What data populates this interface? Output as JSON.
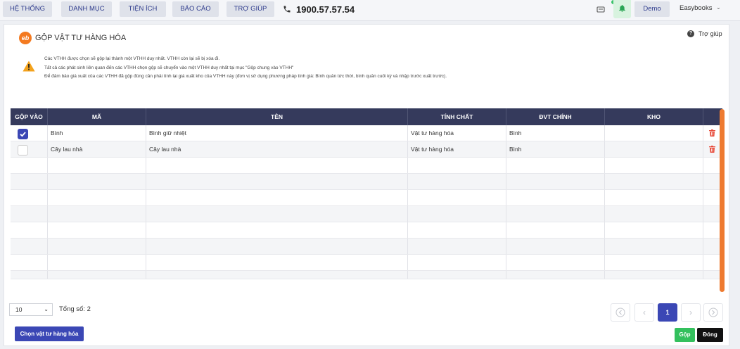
{
  "nav": {
    "items": [
      "HỆ THỐNG",
      "DANH MỤC",
      "TIỆN ÍCH",
      "BÁO CÁO",
      "TRỢ GIÚP"
    ],
    "hotline": "1900.57.57.54",
    "user": "Demo",
    "company": "Easybooks"
  },
  "icons": {
    "phone": "phone-icon",
    "tray": "tray-icon",
    "bell": "bell-icon",
    "warning": "warning-icon",
    "trash": "trash-icon",
    "help": "question-circle-icon"
  },
  "colors": {
    "primary": "#3b47b5",
    "header_bg": "#353a5c",
    "accent_orange": "#ee7a30",
    "success": "#33c05d",
    "danger": "#e74c3c"
  },
  "panel": {
    "logo_text": "eb",
    "title": "GỘP VẬT TƯ HÀNG HÓA",
    "help": "Trợ giúp",
    "notes": [
      "Các VTHH được chọn sẽ gộp lại thành một VTHH duy nhất. VTHH còn lại sẽ bị xóa đi.",
      "Tất cả các phát sinh liên quan đến các VTHH chọn gộp sẽ chuyển vào một VTHH duy nhất tại mục \"Gộp chung vào VTHH\"",
      "Để đảm bảo giá xuất của các VTHH đã gộp đúng cần phải tính lại giá xuất kho của VTHH này (đơn vị sử dụng phương pháp tính giá: Bình quân tức thời, bình quân cuối kỳ và nhập trước xuất trước)."
    ]
  },
  "table": {
    "headers": [
      "GỘP VÀO",
      "MÃ",
      "TÊN",
      "TÍNH CHẤT",
      "ĐVT CHÍNH",
      "KHO"
    ],
    "rows": [
      {
        "checked": true,
        "code": "Bình",
        "name": "Bình giữ nhiệt",
        "type": "Vật tư hàng hóa",
        "unit": "Bình",
        "warehouse": ""
      },
      {
        "checked": false,
        "code": "Cây lau nhà",
        "name": "Cây lau nhà",
        "type": "Vật tư hàng hóa",
        "unit": "Bình",
        "warehouse": ""
      }
    ]
  },
  "footer": {
    "page_size": "10",
    "total": "Tổng số: 2",
    "current_page": "1",
    "choose_label": "Chọn vật tư hàng hóa",
    "merge_label": "Gộp",
    "close_label": "Đóng"
  }
}
